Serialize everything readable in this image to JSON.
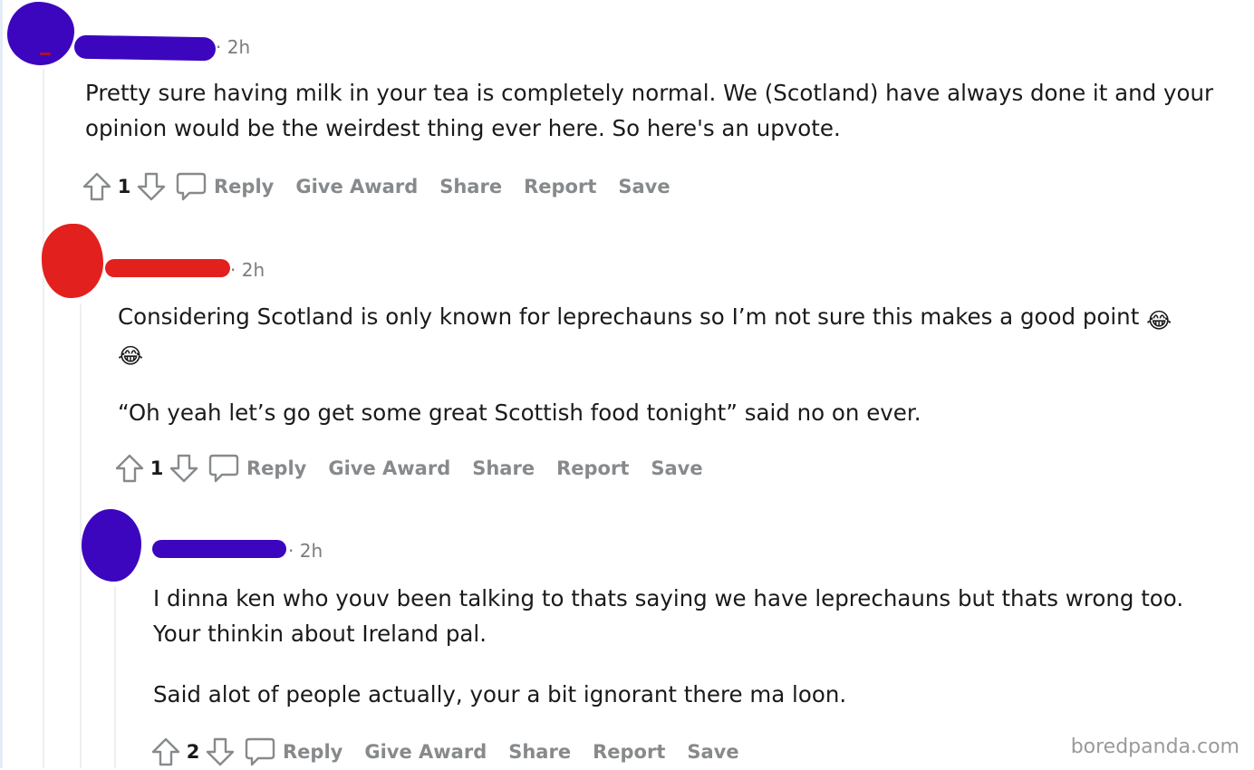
{
  "comments": [
    {
      "time": "· 2h",
      "paragraphs": [
        "Pretty sure having milk in your tea is completely normal. We (Scotland) have always done it and your",
        "opinion would be the weirdest thing ever here. So here's an upvote."
      ],
      "score": "1"
    },
    {
      "time": "· 2h",
      "line1": "Considering Scotland is only known for leprechauns so I’m not sure this makes a good point",
      "emoji": "😂",
      "line3": "“Oh yeah let’s go get some great Scottish food tonight” said no on ever.",
      "score": "1"
    },
    {
      "time": "· 2h",
      "paragraphs": [
        "I dinna ken who youv been talking to thats saying we have leprechauns but thats wrong too.",
        "Your thinkin about Ireland pal.",
        "Said alot of people actually, your a bit ignorant there ma loon."
      ],
      "score": "2"
    }
  ],
  "actions": {
    "reply": "Reply",
    "give_award": "Give Award",
    "share": "Share",
    "report": "Report",
    "save": "Save"
  },
  "icons": {
    "upvote": "upvote-arrow-icon",
    "downvote": "downvote-arrow-icon",
    "reply": "speech-bubble-icon"
  },
  "colors": {
    "avatar_purple": "#3c06be",
    "avatar_red": "#e2201e",
    "action_gray": "#878a8c"
  },
  "watermark": "boredpanda.com"
}
